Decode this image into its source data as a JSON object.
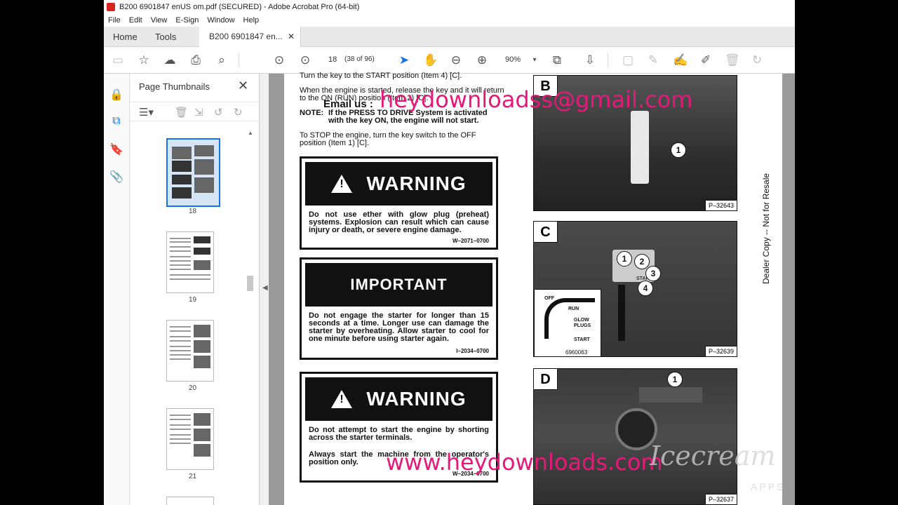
{
  "window": {
    "title": "B200 6901847 enUS om.pdf (SECURED) - Adobe Acrobat Pro (64-bit)"
  },
  "menu": [
    "File",
    "Edit",
    "View",
    "E-Sign",
    "Window",
    "Help"
  ],
  "tabs": {
    "home": "Home",
    "tools": "Tools",
    "document": "B200 6901847 en...",
    "close": "✕"
  },
  "toolbar": {
    "page_number": "18",
    "page_of": "(38 of 96)",
    "zoom": "90%"
  },
  "thumbnails": {
    "title": "Page Thumbnails",
    "close": "✕",
    "pages": [
      "18",
      "19",
      "20",
      "21"
    ]
  },
  "document": {
    "line1": "Turn the key to the START position (Item 4) [C].",
    "line2a": "When the engine is started, release the key and it will return",
    "line2b": "to the ON (RUN) position (Item 2) [C].",
    "note_label": "NOTE:",
    "note_a": "If the PRESS TO DRIVE System is activated",
    "note_b": "with the key ON, the engine will not start.",
    "stop_a": "To  STOP  the engine, turn the key switch to the OFF",
    "stop_b": "position (Item 1) [C].",
    "warning1": {
      "head": "WARNING",
      "body": "Do not use ether with glow plug (preheat) systems. Explosion can result which can cause injury or death, or severe engine damage.",
      "code": "W–2071–0700"
    },
    "important": {
      "head": "IMPORTANT",
      "body": "Do not engage the starter for longer than 15 seconds at a time. Longer use can damage the starter by overheating. Allow starter to cool for one minute before using starter again.",
      "code": "I–2034–0700"
    },
    "warning2": {
      "head": "WARNING",
      "body1": "Do not attempt to start the engine by shorting across the starter terminals.",
      "body2": "Always start the machine from the operator's position only.",
      "code": "W–2034–0700"
    },
    "photos": [
      {
        "letter": "B",
        "code": "P–32643",
        "callouts": [
          "1"
        ]
      },
      {
        "letter": "C",
        "code": "P–32639",
        "callouts": [
          "1",
          "2",
          "3",
          "4"
        ],
        "inset": {
          "off": "OFF",
          "run": "RUN",
          "glow1": "GLOW",
          "glow2": "PLUGS",
          "start": "START",
          "code": "6960063"
        },
        "label": "START"
      },
      {
        "letter": "D",
        "code": "P–32637",
        "callouts": [
          "1"
        ]
      }
    ],
    "side_text": "Dealer Copy -- Not for Resale"
  },
  "watermarks": {
    "email_label": "Email us :",
    "email": "heydownloadss@gmail.com",
    "site": "www.heydownloads.com",
    "brand": "Icecream",
    "brand_sub": "APPS"
  }
}
